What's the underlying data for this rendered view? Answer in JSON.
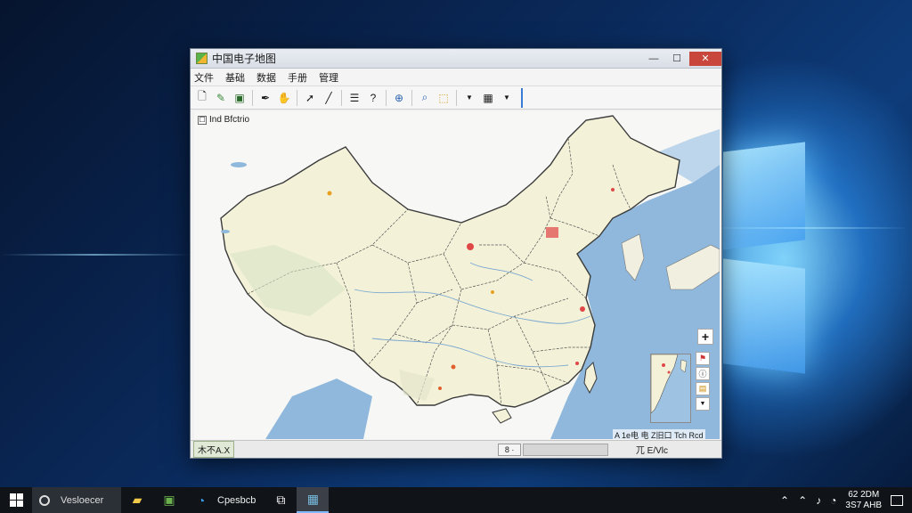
{
  "window": {
    "title": "中国电子地图",
    "controls": {
      "minimize": "—",
      "maximize": "☐",
      "close": "✕"
    }
  },
  "menu": [
    "文件",
    "基础",
    "数据",
    "手册",
    "管理"
  ],
  "toolbar": {
    "tools": [
      "new-icon",
      "edit-icon",
      "save-icon",
      "pen-icon",
      "hand-icon",
      "pointer-icon",
      "line-icon",
      "layers-icon",
      "help-icon",
      "zoom-icon",
      "search-icon",
      "select-icon",
      "dropdown-icon",
      "grid-icon",
      "dropdown-icon"
    ]
  },
  "map": {
    "layer_label": "Ind Bfctrio",
    "zoom_plus": "+",
    "scale_text": "A 1e电 电 Z旧口 Tch Rcd",
    "colors": {
      "land": "#f3f2d8",
      "sea": "#8fb8dc",
      "border": "#4a4a4a"
    }
  },
  "side_tools": [
    "flag-icon",
    "info-icon",
    "image-icon",
    "chevron-down-icon"
  ],
  "status": {
    "left": "木不A.X",
    "mid": "8 ·",
    "right": "兀 E/Vlc"
  },
  "taskbar": {
    "search_text": "Vesloecer",
    "app_label": "Cpesbcb",
    "time": "62 2DM",
    "date": "3S7 AHB",
    "tray_icons": [
      "chevron-up-icon",
      "network-icon",
      "volume-icon",
      "wifi-icon"
    ]
  }
}
